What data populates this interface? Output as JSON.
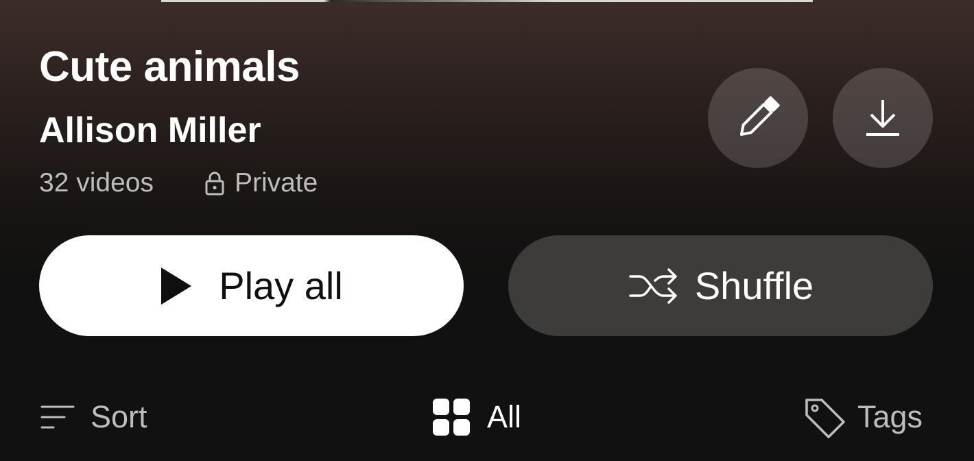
{
  "playlist": {
    "title": "Cute animals",
    "owner": "Allison Miller",
    "video_count": "32 videos",
    "privacy": "Private"
  },
  "actions": {
    "play_all_label": "Play all",
    "shuffle_label": "Shuffle"
  },
  "icons": {
    "edit": "pencil-icon",
    "download": "download-icon",
    "privacy": "lock-icon",
    "play": "play-icon",
    "shuffle": "shuffle-icon",
    "sort": "sort-icon",
    "all": "grid-icon",
    "tags": "tag-icon"
  },
  "filters": {
    "sort_label": "Sort",
    "all_label": "All",
    "tags_label": "Tags",
    "selected": "All"
  },
  "colors": {
    "header_gradient_top": "#3d2c29",
    "background": "#111111",
    "primary_button": "#ffffff",
    "secondary_button": "#3d3c3b",
    "muted_text": "#bdbdbd"
  }
}
